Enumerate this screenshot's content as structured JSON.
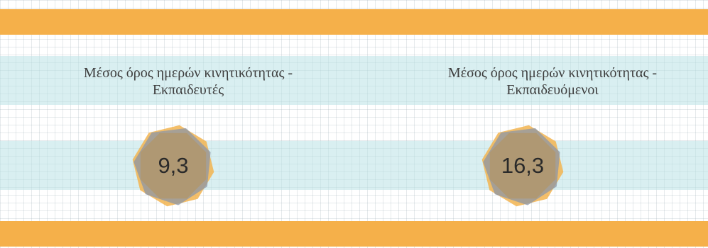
{
  "colors": {
    "orange_bar": "#f5b04a",
    "teal_band": "#bae2e6",
    "badge_fill": "#b0976f",
    "badge_orange": "#f2b450",
    "badge_grey": "#8c96a6"
  },
  "panels": [
    {
      "title_line1": "Μέσος όρος ημερών κινητικότητας -",
      "title_line2": "Εκπαιδευτές",
      "value": "9,3"
    },
    {
      "title_line1": "Μέσος όρος ημερών κινητικότητας -",
      "title_line2": "Εκπαιδευόμενοι",
      "value": "16,3"
    }
  ]
}
